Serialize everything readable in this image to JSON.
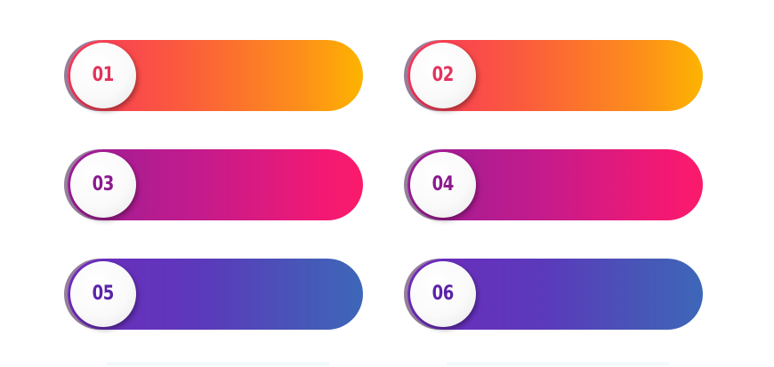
{
  "banners": [
    {
      "number": "01",
      "text_color": "#e3335d",
      "gradient": [
        "#f7355d",
        "#fdb400"
      ]
    },
    {
      "number": "02",
      "text_color": "#e3335d",
      "gradient": [
        "#f7355d",
        "#fdb400"
      ]
    },
    {
      "number": "03",
      "text_color": "#8b1b8e",
      "gradient": [
        "#9a1d97",
        "#fb1a6b"
      ]
    },
    {
      "number": "04",
      "text_color": "#8b1b8e",
      "gradient": [
        "#9a1d97",
        "#fb1a6b"
      ]
    },
    {
      "number": "05",
      "text_color": "#5a24a8",
      "gradient": [
        "#6f2bbd",
        "#3d67b8"
      ]
    },
    {
      "number": "06",
      "text_color": "#5a24a8",
      "gradient": [
        "#6f2bbd",
        "#3d67b8"
      ]
    }
  ]
}
